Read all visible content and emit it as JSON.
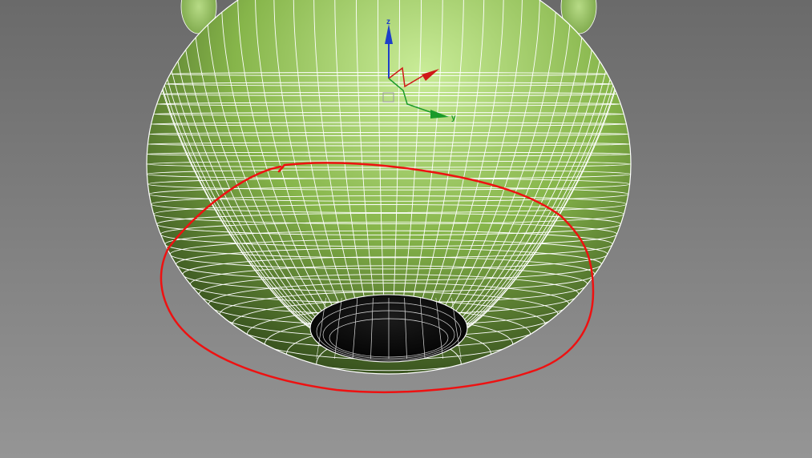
{
  "viewport": {
    "background_top": "#6a6a6a",
    "background_bottom": "#959595"
  },
  "mesh": {
    "fill_light": "#c9ec98",
    "fill_mid": "#86b54a",
    "fill_dark": "#2d4418",
    "wire_color": "#ffffff"
  },
  "gizmo": {
    "axes": [
      {
        "key": "z",
        "label": "z",
        "color": "#1e3fc8"
      },
      {
        "key": "x",
        "label": "",
        "color": "#d01818"
      },
      {
        "key": "y",
        "label": "y",
        "color": "#1a9a2a"
      }
    ]
  },
  "annotation": {
    "shape": "freehand-ellipse",
    "color": "#ee1111"
  }
}
